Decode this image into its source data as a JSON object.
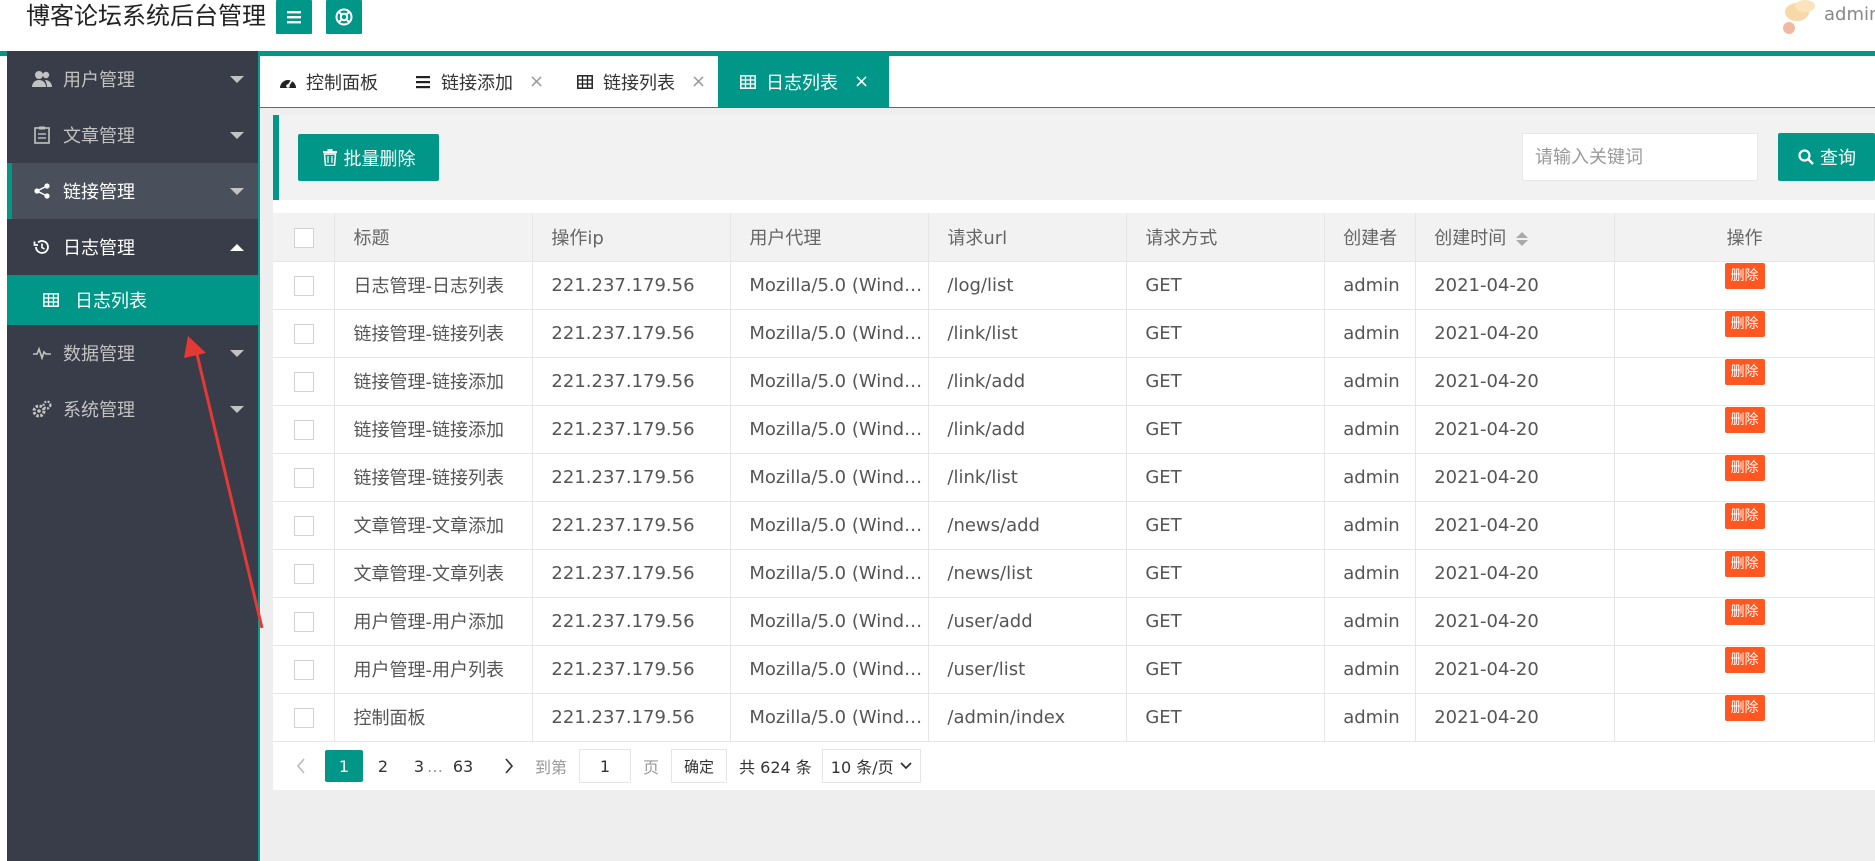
{
  "header": {
    "title": "博客论坛系统后台管理",
    "user": "admin"
  },
  "sidebar": {
    "items": [
      {
        "label": "用户管理",
        "icon": "users-icon"
      },
      {
        "label": "文章管理",
        "icon": "clipboard-icon"
      },
      {
        "label": "链接管理",
        "icon": "share-icon"
      },
      {
        "label": "日志管理",
        "icon": "history-icon"
      },
      {
        "label": "数据管理",
        "icon": "pulse-icon"
      },
      {
        "label": "系统管理",
        "icon": "gears-icon"
      }
    ],
    "sub_item": {
      "label": "日志列表",
      "icon": "table-icon"
    }
  },
  "tabs": [
    {
      "label": "控制面板",
      "icon": "dashboard-icon"
    },
    {
      "label": "链接添加",
      "icon": "list-icon"
    },
    {
      "label": "链接列表",
      "icon": "table-icon"
    },
    {
      "label": "日志列表",
      "icon": "table-icon"
    }
  ],
  "toolbar": {
    "batch_delete": "批量删除",
    "search_placeholder": "请输入关键词",
    "search_button": "查询"
  },
  "table": {
    "columns": [
      "标题",
      "操作ip",
      "用户代理",
      "请求url",
      "请求方式",
      "创建者",
      "创建时间",
      "操作"
    ],
    "delete_label": "删除",
    "rows": [
      {
        "title": "日志管理-日志列表",
        "ip": "221.237.179.56",
        "agent": "Mozilla/5.0 (Wind…",
        "url": "/log/list",
        "method": "GET",
        "creator": "admin",
        "time": "2021-04-20"
      },
      {
        "title": "链接管理-链接列表",
        "ip": "221.237.179.56",
        "agent": "Mozilla/5.0 (Wind…",
        "url": "/link/list",
        "method": "GET",
        "creator": "admin",
        "time": "2021-04-20"
      },
      {
        "title": "链接管理-链接添加",
        "ip": "221.237.179.56",
        "agent": "Mozilla/5.0 (Wind…",
        "url": "/link/add",
        "method": "GET",
        "creator": "admin",
        "time": "2021-04-20"
      },
      {
        "title": "链接管理-链接添加",
        "ip": "221.237.179.56",
        "agent": "Mozilla/5.0 (Wind…",
        "url": "/link/add",
        "method": "GET",
        "creator": "admin",
        "time": "2021-04-20"
      },
      {
        "title": "链接管理-链接列表",
        "ip": "221.237.179.56",
        "agent": "Mozilla/5.0 (Wind…",
        "url": "/link/list",
        "method": "GET",
        "creator": "admin",
        "time": "2021-04-20"
      },
      {
        "title": "文章管理-文章添加",
        "ip": "221.237.179.56",
        "agent": "Mozilla/5.0 (Wind…",
        "url": "/news/add",
        "method": "GET",
        "creator": "admin",
        "time": "2021-04-20"
      },
      {
        "title": "文章管理-文章列表",
        "ip": "221.237.179.56",
        "agent": "Mozilla/5.0 (Wind…",
        "url": "/news/list",
        "method": "GET",
        "creator": "admin",
        "time": "2021-04-20"
      },
      {
        "title": "用户管理-用户添加",
        "ip": "221.237.179.56",
        "agent": "Mozilla/5.0 (Wind…",
        "url": "/user/add",
        "method": "GET",
        "creator": "admin",
        "time": "2021-04-20"
      },
      {
        "title": "用户管理-用户列表",
        "ip": "221.237.179.56",
        "agent": "Mozilla/5.0 (Wind…",
        "url": "/user/list",
        "method": "GET",
        "creator": "admin",
        "time": "2021-04-20"
      },
      {
        "title": "控制面板",
        "ip": "221.237.179.56",
        "agent": "Mozilla/5.0 (Wind…",
        "url": "/admin/index",
        "method": "GET",
        "creator": "admin",
        "time": "2021-04-20"
      }
    ]
  },
  "pagination": {
    "pages": [
      "1",
      "2",
      "3",
      "…",
      "63"
    ],
    "current": "1",
    "goto_label": "到第",
    "goto_value": "1",
    "page_unit": "页",
    "confirm": "确定",
    "total": "共 624 条",
    "page_size": "10 条/页"
  },
  "colors": {
    "accent": "#009688",
    "sidebar_bg": "#393d49",
    "danger": "#ff5722"
  }
}
